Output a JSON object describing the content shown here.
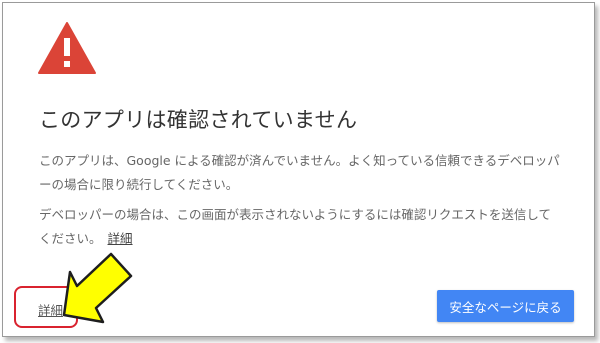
{
  "warning": {
    "icon": "warning-triangle-icon",
    "color": "#db4437"
  },
  "title": "このアプリは確認されていません",
  "paragraph1": "このアプリは、Google による確認が済んでいません。よく知っている信頼できるデベロッパーの場合に限り続行してください。",
  "paragraph2": "デベロッパーの場合は、この画面が表示されないようにするには確認リクエストを送信してください。",
  "inline_details_link": "詳細",
  "details_link": "詳細",
  "back_button": {
    "label": "安全なページに戻る",
    "color": "#4286f4"
  },
  "annotation": {
    "arrow_color": "#ffff00",
    "highlight_color": "#d9232f"
  }
}
